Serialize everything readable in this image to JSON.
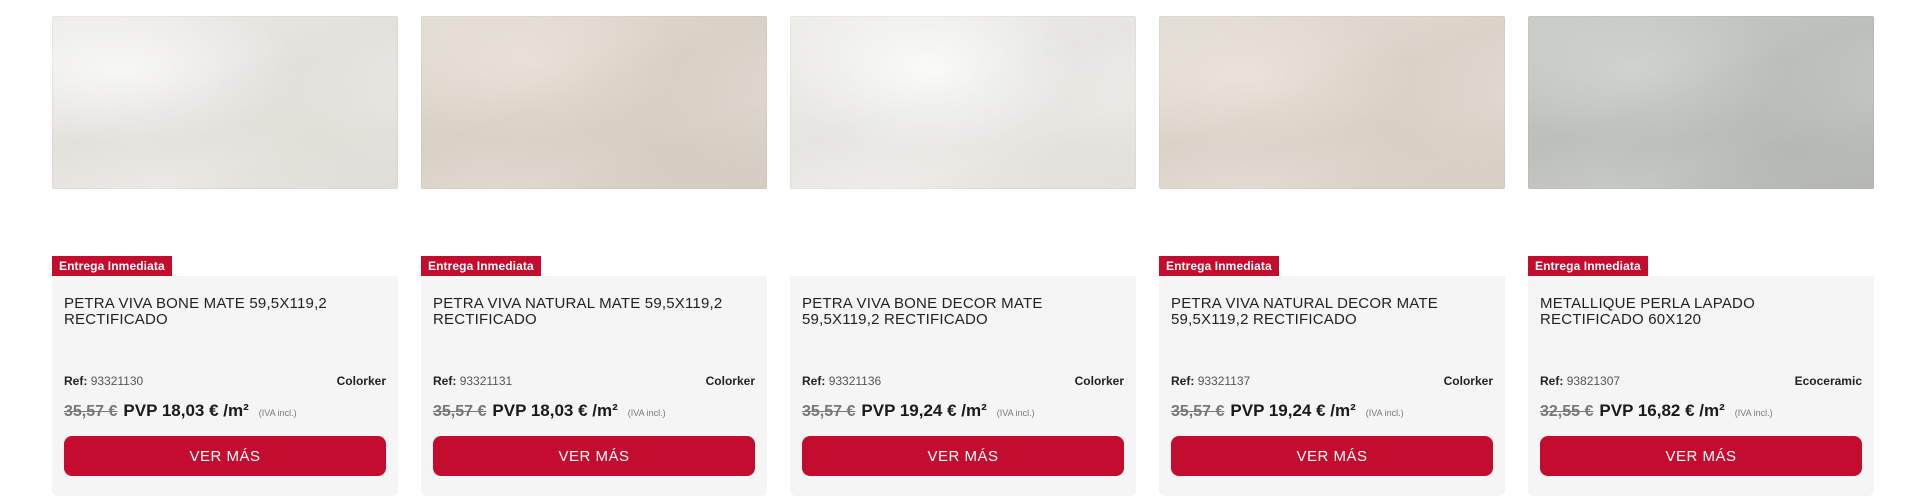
{
  "products": [
    {
      "title": "PETRA VIVA BONE MATE 59,5X119,2 RECTIFICADO",
      "badge": "Entrega Inmediata",
      "ref_label": "Ref:",
      "ref_value": "93321130",
      "brand": "Colorker",
      "old_price": "35,57 €",
      "new_price": "PVP 18,03 € /m²",
      "tax_note": "(IVA incl.)",
      "cta_label": "VER MÁS",
      "tile_tone": "bone"
    },
    {
      "title": "PETRA VIVA NATURAL MATE 59,5X119,2 RECTIFICADO",
      "badge": "Entrega Inmediata",
      "ref_label": "Ref:",
      "ref_value": "93321131",
      "brand": "Colorker",
      "old_price": "35,57 €",
      "new_price": "PVP 18,03 € /m²",
      "tax_note": "(IVA incl.)",
      "cta_label": "VER MÁS",
      "tile_tone": "natural"
    },
    {
      "title": "PETRA VIVA BONE DECOR MATE 59,5X119,2 RECTIFICADO",
      "badge": "",
      "ref_label": "Ref:",
      "ref_value": "93321136",
      "brand": "Colorker",
      "old_price": "35,57 €",
      "new_price": "PVP 19,24 € /m²",
      "tax_note": "(IVA incl.)",
      "cta_label": "VER MÁS",
      "tile_tone": "bone-decor"
    },
    {
      "title": "PETRA VIVA NATURAL DECOR MATE 59,5X119,2 RECTIFICADO",
      "badge": "Entrega Inmediata",
      "ref_label": "Ref:",
      "ref_value": "93321137",
      "brand": "Colorker",
      "old_price": "35,57 €",
      "new_price": "PVP 19,24 € /m²",
      "tax_note": "(IVA incl.)",
      "cta_label": "VER MÁS",
      "tile_tone": "natural-decor"
    },
    {
      "title": "METALLIQUE PERLA LAPADO RECTIFICADO 60X120",
      "badge": "Entrega Inmediata",
      "ref_label": "Ref:",
      "ref_value": "93821307",
      "brand": "Ecoceramic",
      "old_price": "32,55 €",
      "new_price": "PVP 16,82 € /m²",
      "tax_note": "(IVA incl.)",
      "cta_label": "VER MÁS",
      "tile_tone": "perla"
    }
  ],
  "colors": {
    "accent": "#c40c2f",
    "card_background": "#f5f5f5"
  }
}
